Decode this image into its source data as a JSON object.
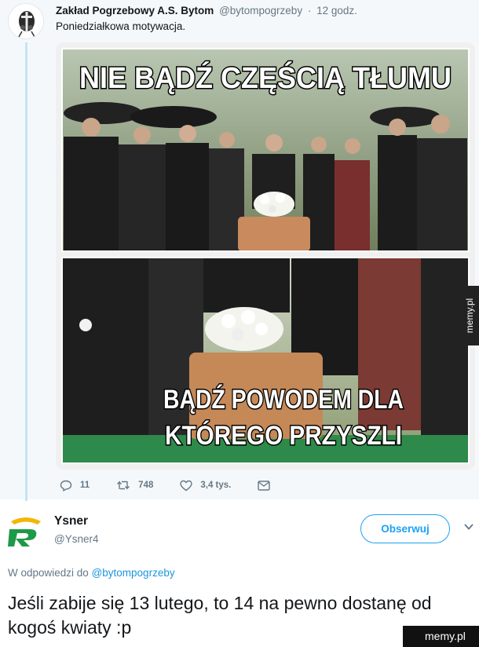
{
  "tweet1": {
    "author_name": "Zakład Pogrzebowy A.S. Bytom",
    "handle": "@bytompogrzeby",
    "separator": "·",
    "time": "12 godz.",
    "text": "Poniedziałkowa motywacja.",
    "meme": {
      "top_caption": "NIE BĄDŹ CZĘŚCIĄ TŁUMU",
      "bottom_caption_line1": "BĄDŹ POWODEM DLA",
      "bottom_caption_line2": "KTÓREGO PRZYSZLI"
    },
    "actions": {
      "replies": "11",
      "retweets": "748",
      "likes": "3,4 tys."
    }
  },
  "tweet2": {
    "author_name": "Ysner",
    "handle": "@Ysner4",
    "follow_label": "Obserwuj",
    "reply_to_prefix": "W odpowiedzi do",
    "reply_to_mention": "@bytompogrzeby",
    "text": "Jeśli zabije się 13 lutego, to 14 na pewno dostanę od kogoś kwiaty :p"
  },
  "watermark": {
    "side": "memy.pl",
    "bottom": "memy.pl"
  },
  "colors": {
    "accent": "#1da1f2",
    "link": "#1b95e0",
    "muted": "#657786",
    "thread_line": "#c4e3f7",
    "logo_green": "#1e9a46",
    "logo_gold": "#f2b705"
  },
  "icons": {
    "reply": "reply-icon",
    "retweet": "retweet-icon",
    "like": "heart-icon",
    "dm": "envelope-icon",
    "more": "chevron-down-icon"
  }
}
